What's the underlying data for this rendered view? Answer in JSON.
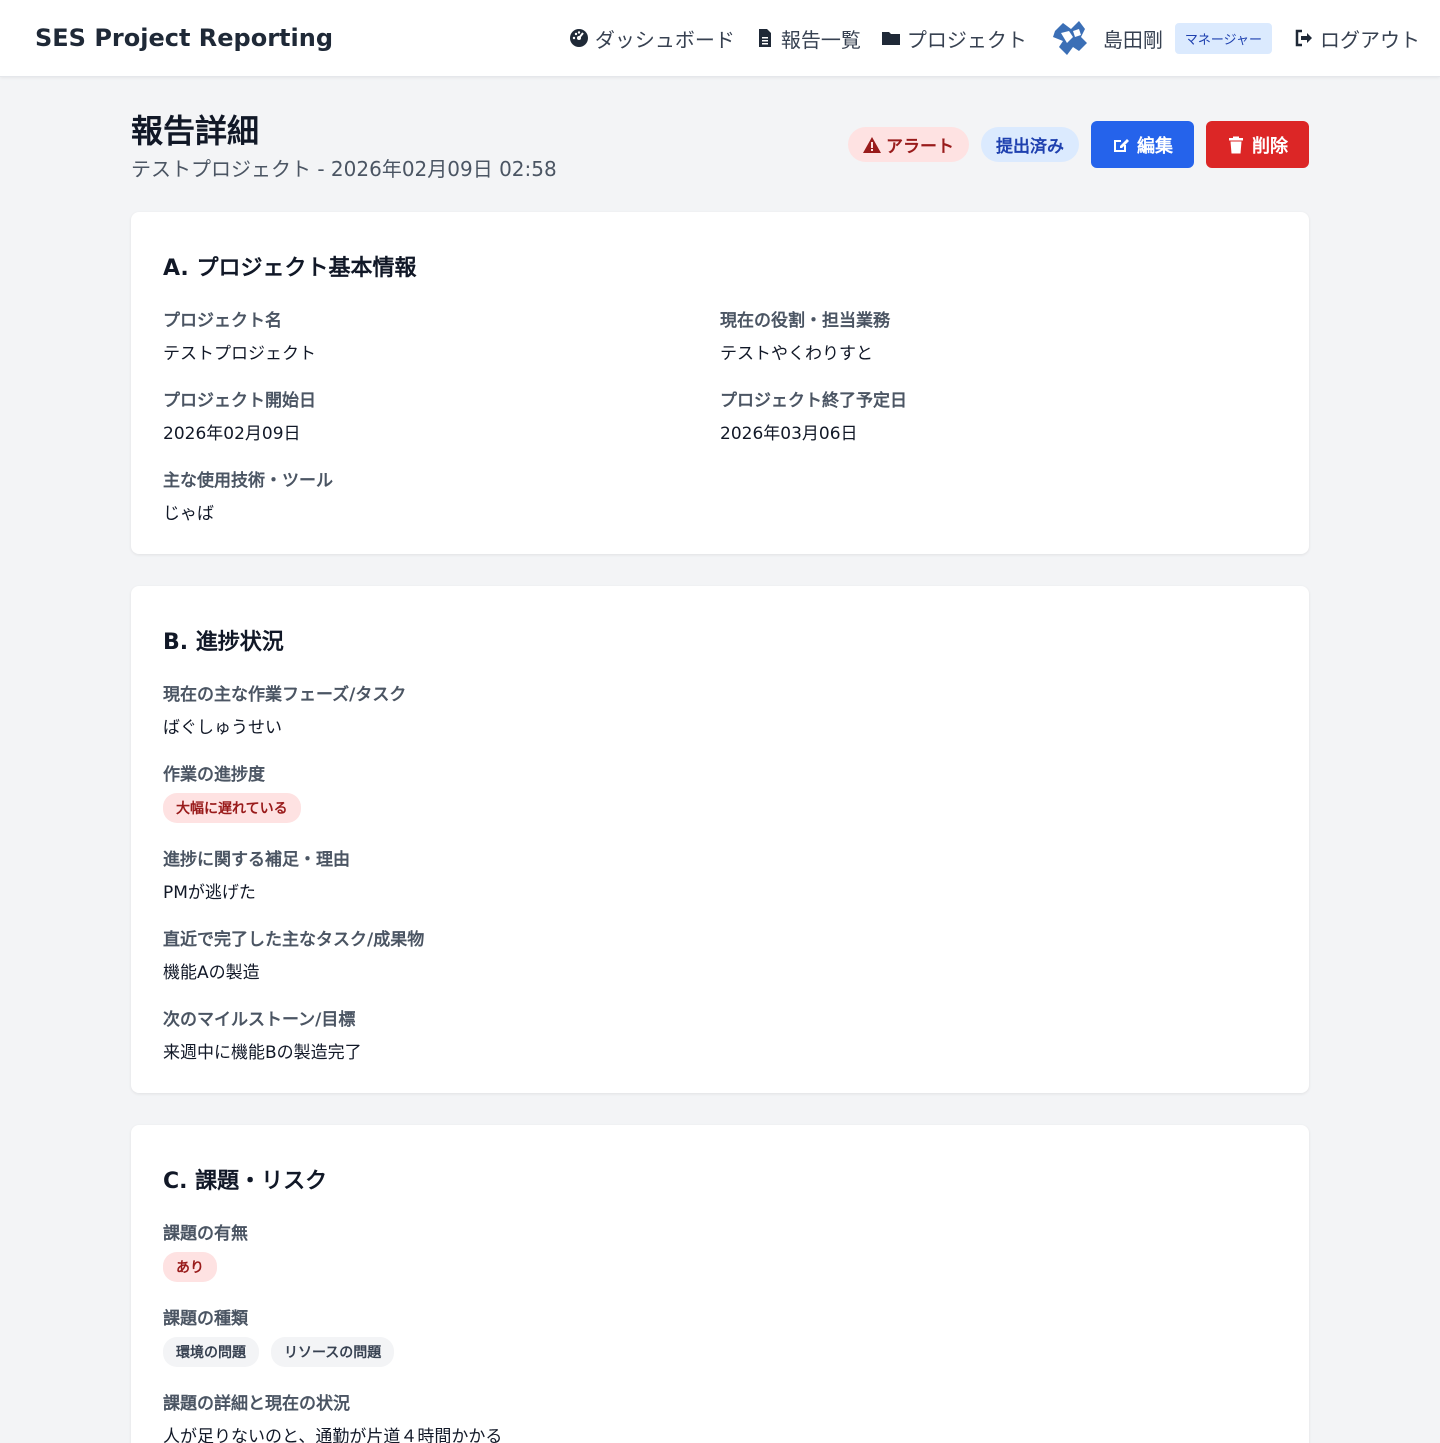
{
  "nav": {
    "brand": "SES Project Reporting",
    "dashboard": "ダッシュボード",
    "reports": "報告一覧",
    "projects": "プロジェクト",
    "user_name": "島田剛",
    "role": "マネージャー",
    "logout": "ログアウト"
  },
  "header": {
    "title": "報告詳細",
    "subtitle": "テストプロジェクト - 2026年02月09日 02:58",
    "alert_label": "アラート",
    "status_label": "提出済み",
    "edit_label": "編集",
    "delete_label": "削除"
  },
  "section_a": {
    "title": "A. プロジェクト基本情報",
    "project_name_label": "プロジェクト名",
    "project_name": "テストプロジェクト",
    "role_label": "現在の役割・担当業務",
    "role": "テストやくわりすと",
    "start_label": "プロジェクト開始日",
    "start": "2026年02月09日",
    "end_label": "プロジェクト終了予定日",
    "end": "2026年03月06日",
    "tech_label": "主な使用技術・ツール",
    "tech": "じゃば"
  },
  "section_b": {
    "title": "B. 進捗状況",
    "phase_label": "現在の主な作業フェーズ/タスク",
    "phase": "ばぐしゅうせい",
    "progress_label": "作業の進捗度",
    "progress": "大幅に遅れている",
    "reason_label": "進捗に関する補足・理由",
    "reason": "PMが逃げた",
    "done_label": "直近で完了した主なタスク/成果物",
    "done": "機能Aの製造",
    "next_label": "次のマイルストーン/目標",
    "next": "来週中に機能Bの製造完了"
  },
  "section_c": {
    "title": "C. 課題・リスク",
    "has_issue_label": "課題の有無",
    "has_issue": "あり",
    "types_label": "課題の種類",
    "types": [
      "環境の問題",
      "リソースの問題"
    ],
    "detail_label": "課題の詳細と現在の状況",
    "detail": "人が足りないのと、通勤が片道４時間かかる"
  }
}
